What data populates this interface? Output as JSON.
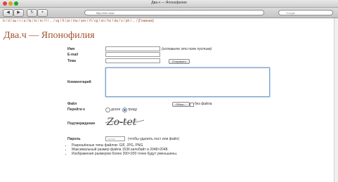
{
  "window": {
    "title": "Два.ч — Японофилия"
  },
  "toolbar": {
    "back": "◀",
    "forward": "▶",
    "address": "http://2ch.ru/a/",
    "search_placeholder": "Google"
  },
  "board_links": "b / d / au / r / a / fa / tv / m / f / ... / vg / fi / pr / mu / sex / rf / cg / sn / hc / da / s / ph / ... / [Главная]",
  "board_title": "Два.ч — Японофилия",
  "form": {
    "name_label": "Имя",
    "name_note": "(оставьте это поле пустым)",
    "email_label": "E-mail",
    "subject_label": "Тема",
    "submit_label": "Отправить",
    "comment_label": "Комментарий",
    "file_label": "Файл",
    "browse_label": "Обзор...",
    "no_file_label": "без файла",
    "goto_label": "Перейти к",
    "goto_board": "доске",
    "goto_thread": "треду",
    "confirm_label": "Подтверждение",
    "captcha_text": "Zo-tet",
    "password_label": "Пароль",
    "password_value": "••••••••",
    "password_note": "(чтобы удалить пост или файл)"
  },
  "rules": [
    "Разрешённые типы файлов: GIF, JPG, PNG",
    "Максимальный размер файла 1536 килобайт и 2048×2048.",
    "Изображения размером более 200×200 точек будут уменьшены."
  ]
}
